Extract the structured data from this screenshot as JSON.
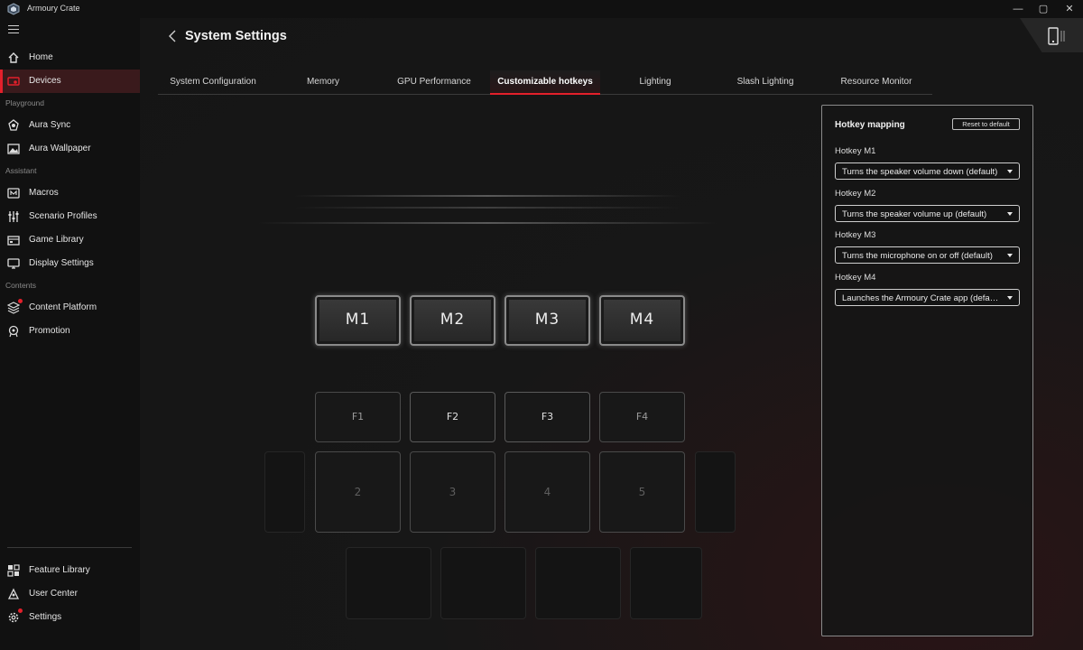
{
  "window": {
    "title": "Armoury Crate",
    "controls": {
      "minimize": "—",
      "maximize": "▢",
      "close": "✕"
    }
  },
  "sidebar": {
    "items": [
      {
        "label": "Home",
        "icon": "home-icon"
      },
      {
        "label": "Devices",
        "icon": "devices-icon",
        "active": true
      }
    ],
    "sections": [
      {
        "label": "Playground",
        "items": [
          {
            "label": "Aura Sync",
            "icon": "aura-sync-icon"
          },
          {
            "label": "Aura Wallpaper",
            "icon": "wallpaper-icon"
          }
        ]
      },
      {
        "label": "Assistant",
        "items": [
          {
            "label": "Macros",
            "icon": "macros-icon"
          },
          {
            "label": "Scenario Profiles",
            "icon": "scenario-profiles-icon"
          },
          {
            "label": "Game Library",
            "icon": "game-library-icon"
          },
          {
            "label": "Display Settings",
            "icon": "display-settings-icon"
          }
        ]
      },
      {
        "label": "Contents",
        "items": [
          {
            "label": "Content Platform",
            "icon": "content-platform-icon",
            "notification": true
          },
          {
            "label": "Promotion",
            "icon": "promotion-icon"
          }
        ]
      }
    ],
    "bottom": [
      {
        "label": "Feature Library",
        "icon": "feature-library-icon"
      },
      {
        "label": "User Center",
        "icon": "user-center-icon"
      },
      {
        "label": "Settings",
        "icon": "settings-icon",
        "notification": true
      }
    ]
  },
  "header": {
    "title": "System Settings"
  },
  "tabs": [
    {
      "label": "System Configuration"
    },
    {
      "label": "Memory"
    },
    {
      "label": "GPU Performance"
    },
    {
      "label": "Customizable hotkeys",
      "active": true
    },
    {
      "label": "Lighting"
    },
    {
      "label": "Slash Lighting"
    },
    {
      "label": "Resource Monitor"
    }
  ],
  "keyboard": {
    "macro_keys": [
      "M1",
      "M2",
      "M3",
      "M4"
    ],
    "function_keys": [
      "F1",
      "F2",
      "F3",
      "F4"
    ],
    "number_keys": [
      "2",
      "3",
      "4",
      "5"
    ]
  },
  "hotkey_panel": {
    "title": "Hotkey mapping",
    "reset_label": "Reset to default",
    "hotkeys": [
      {
        "label": "Hotkey M1",
        "value": "Turns the speaker volume down (default)"
      },
      {
        "label": "Hotkey M2",
        "value": "Turns the speaker volume up (default)"
      },
      {
        "label": "Hotkey M3",
        "value": "Turns the microphone on or off (default)"
      },
      {
        "label": "Hotkey M4",
        "value": "Launches the Armoury Crate app (default)"
      }
    ]
  },
  "colors": {
    "accent": "#e3202b",
    "background": "#151515",
    "sidebar": "#111111"
  }
}
